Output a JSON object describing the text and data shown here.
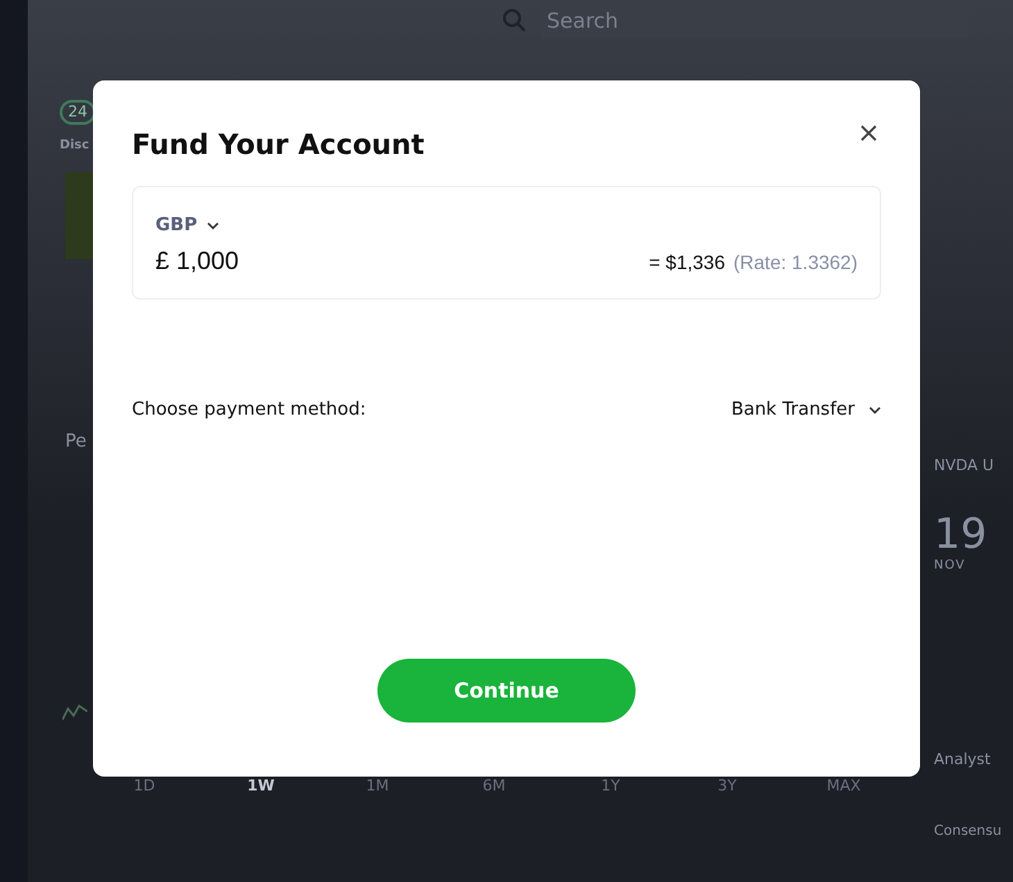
{
  "search": {
    "placeholder": "Search"
  },
  "background": {
    "pill": "24",
    "tab": "Disc",
    "section_title": "Pe",
    "timeframes": [
      {
        "label": "1D",
        "selected": false
      },
      {
        "label": "1W",
        "selected": true
      },
      {
        "label": "1M",
        "selected": false
      },
      {
        "label": "6M",
        "selected": false
      },
      {
        "label": "1Y",
        "selected": false
      },
      {
        "label": "3Y",
        "selected": false
      },
      {
        "label": "MAX",
        "selected": false
      }
    ],
    "side_title": "NVDA U",
    "date_day": "19",
    "date_month": "NOV",
    "analyst": "Analyst",
    "consensus": "Consensu"
  },
  "modal": {
    "title": "Fund Your Account",
    "currency": "GBP",
    "amount": "£ 1,000",
    "converted": "= $1,336",
    "rate": "(Rate: 1.3362)",
    "payment_label": "Choose payment method:",
    "payment_method": "Bank Transfer",
    "button": "Continue"
  }
}
